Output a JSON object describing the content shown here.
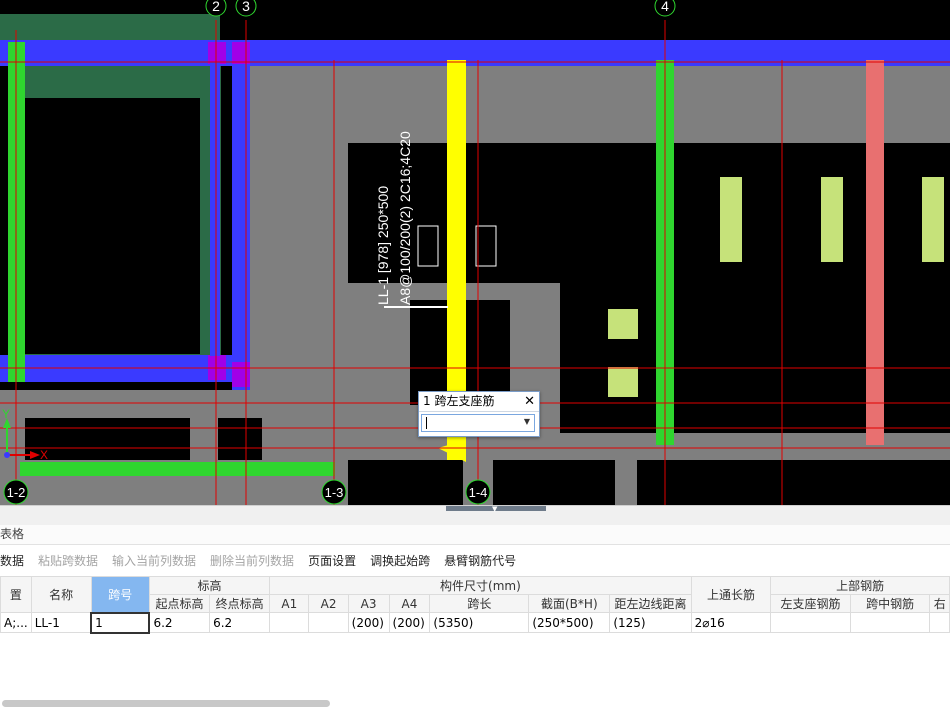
{
  "cad": {
    "axis_top": [
      "2",
      "3",
      "4"
    ],
    "axis_bottom": [
      "1-2",
      "1-3",
      "1-4"
    ],
    "beam_label_line1": "LL-1 [978] 250*500",
    "beam_label_line2": "A8@100/200(2) 2C16;4C20",
    "ucs_x": "X",
    "ucs_y": "Y"
  },
  "popup": {
    "title": "1 跨左支座筋",
    "close": "✕",
    "input_value": "",
    "dropdown_icon": "chevron-down"
  },
  "panel": {
    "title": "表格"
  },
  "toolbar": {
    "items": [
      {
        "label": "数据",
        "enabled": true
      },
      {
        "label": "粘贴跨数据",
        "enabled": false
      },
      {
        "label": "输入当前列数据",
        "enabled": false
      },
      {
        "label": "删除当前列数据",
        "enabled": false
      },
      {
        "label": "页面设置",
        "enabled": true
      },
      {
        "label": "调换起始跨",
        "enabled": true
      },
      {
        "label": "悬臂钢筋代号",
        "enabled": true
      }
    ]
  },
  "table": {
    "group_headers": {
      "biaogao": "标高",
      "goujian": "构件尺寸(mm)",
      "shangbu": "上部钢筋"
    },
    "headers": {
      "c0": "置",
      "mingcheng": "名称",
      "kuahao": "跨号",
      "qidian": "起点标高",
      "zhongdian": "终点标高",
      "a1": "A1",
      "a2": "A2",
      "a3": "A3",
      "a4": "A4",
      "kuachang": "跨长",
      "jiemian": "截面(B*H)",
      "juzuo": "距左边线距离",
      "shangtong": "上通长筋",
      "zuozhi": "左支座钢筋",
      "kuazhong": "跨中钢筋",
      "extra": "右"
    },
    "row": {
      "c0": "A;...",
      "mingcheng": "LL-1",
      "kuahao": "1",
      "qidian": "6.2",
      "zhongdian": "6.2",
      "a1": "",
      "a2": "",
      "a3": "(200)",
      "a4": "(200)",
      "kuachang": "(5350)",
      "jiemian": "(250*500)",
      "juzuo": "(125)",
      "shangtong": "2⌀16",
      "zuozhi": "",
      "kuazhong": "",
      "extra": ""
    }
  }
}
